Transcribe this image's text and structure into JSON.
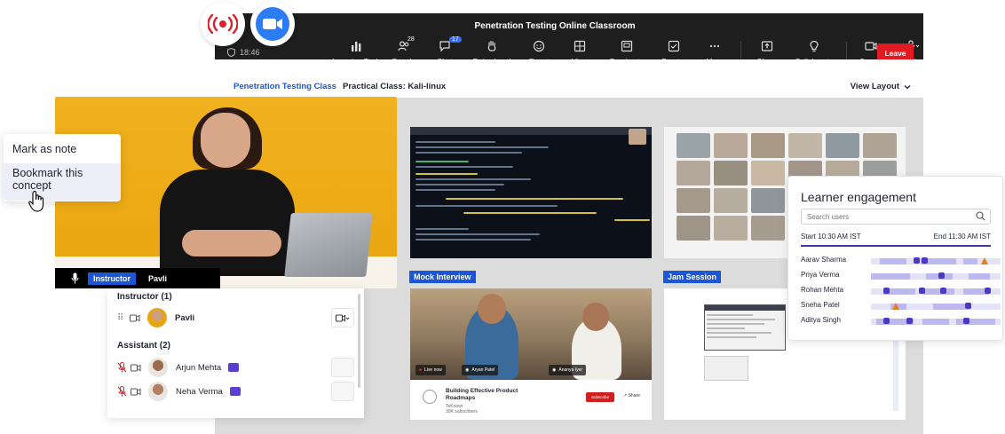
{
  "window": {
    "title": "Penetration Testing Online Classroom",
    "time": "18:46",
    "toolbar": [
      {
        "label": "Learning Tools",
        "icon": "learning-tools-icon",
        "badge": ""
      },
      {
        "label": "People",
        "icon": "people-icon",
        "badge": "28"
      },
      {
        "label": "Chat",
        "icon": "chat-icon",
        "badge": "17"
      },
      {
        "label": "Raise hand",
        "icon": "raise-hand-icon",
        "badge": ""
      },
      {
        "label": "React",
        "icon": "react-icon",
        "badge": ""
      },
      {
        "label": "View",
        "icon": "view-icon",
        "badge": ""
      },
      {
        "label": "Breakouts",
        "icon": "breakouts-icon",
        "badge": ""
      },
      {
        "label": "Proctor",
        "icon": "proctor-icon",
        "badge": ""
      },
      {
        "label": "More",
        "icon": "more-icon",
        "badge": ""
      },
      {
        "label": "Share",
        "icon": "share-icon",
        "badge": ""
      },
      {
        "label": "Collaborate",
        "icon": "collaborate-icon",
        "badge": ""
      },
      {
        "label": "Camera",
        "icon": "camera-icon",
        "badge": ""
      },
      {
        "label": "Mic",
        "icon": "mic-icon",
        "badge": ""
      }
    ],
    "leave_label": "Leave",
    "colors": {
      "accent": "#1a56d6",
      "leave": "#e21b22",
      "topbar": "#1e1e1e",
      "engagement": "#4b38c9"
    }
  },
  "subbar": {
    "tab_active": "Penetration Testing Class",
    "tab_second": "Practical Class: Kali-linux",
    "view_layout": "View Layout"
  },
  "tiles": {
    "mock_label": "Mock Interview",
    "jam_label": "Jam Session",
    "mock": {
      "chip_live": "Live now",
      "chip_1": "Aryan Patel",
      "chip_2": "Ananya Iyer",
      "video_title": "Building Effective Product Roadmaps",
      "channel": "TeKnowr",
      "subs": "30K subscribers",
      "subscribe": "Subscribe",
      "share": "Share"
    }
  },
  "speaker": {
    "role": "Instructor",
    "name": "Pavli"
  },
  "context_menu": {
    "item_1": "Mark as note",
    "item_2": "Bookmark this concept"
  },
  "participants": {
    "instructor_header": "Instructor (1)",
    "assistant_header": "Assistant (2)",
    "instructor": [
      {
        "name": "Pavli"
      }
    ],
    "assistants": [
      {
        "name": "Arjun Mehta"
      },
      {
        "name": "Neha Verma"
      }
    ]
  },
  "engagement": {
    "title": "Learner engagement",
    "search_placeholder": "Search users",
    "start": "Start 10:30 AM IST",
    "end": "End 11:30 AM IST",
    "learners": [
      {
        "name": "Aarav Sharma"
      },
      {
        "name": "Priya Verma"
      },
      {
        "name": "Rohan Mehta"
      },
      {
        "name": "Sneha Patel"
      },
      {
        "name": "Aditya Singh"
      }
    ]
  }
}
